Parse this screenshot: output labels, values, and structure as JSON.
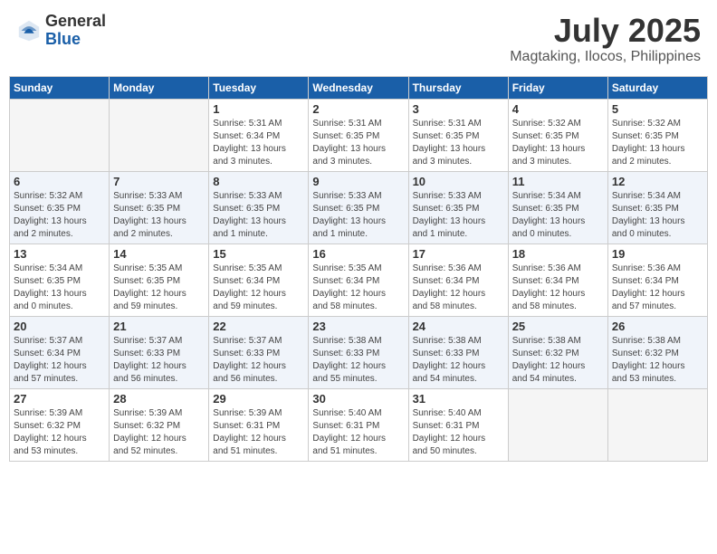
{
  "logo": {
    "general": "General",
    "blue": "Blue"
  },
  "title": "July 2025",
  "location": "Magtaking, Ilocos, Philippines",
  "days_of_week": [
    "Sunday",
    "Monday",
    "Tuesday",
    "Wednesday",
    "Thursday",
    "Friday",
    "Saturday"
  ],
  "weeks": [
    [
      {
        "day": "",
        "detail": ""
      },
      {
        "day": "",
        "detail": ""
      },
      {
        "day": "1",
        "detail": "Sunrise: 5:31 AM\nSunset: 6:34 PM\nDaylight: 13 hours\nand 3 minutes."
      },
      {
        "day": "2",
        "detail": "Sunrise: 5:31 AM\nSunset: 6:35 PM\nDaylight: 13 hours\nand 3 minutes."
      },
      {
        "day": "3",
        "detail": "Sunrise: 5:31 AM\nSunset: 6:35 PM\nDaylight: 13 hours\nand 3 minutes."
      },
      {
        "day": "4",
        "detail": "Sunrise: 5:32 AM\nSunset: 6:35 PM\nDaylight: 13 hours\nand 3 minutes."
      },
      {
        "day": "5",
        "detail": "Sunrise: 5:32 AM\nSunset: 6:35 PM\nDaylight: 13 hours\nand 2 minutes."
      }
    ],
    [
      {
        "day": "6",
        "detail": "Sunrise: 5:32 AM\nSunset: 6:35 PM\nDaylight: 13 hours\nand 2 minutes."
      },
      {
        "day": "7",
        "detail": "Sunrise: 5:33 AM\nSunset: 6:35 PM\nDaylight: 13 hours\nand 2 minutes."
      },
      {
        "day": "8",
        "detail": "Sunrise: 5:33 AM\nSunset: 6:35 PM\nDaylight: 13 hours\nand 1 minute."
      },
      {
        "day": "9",
        "detail": "Sunrise: 5:33 AM\nSunset: 6:35 PM\nDaylight: 13 hours\nand 1 minute."
      },
      {
        "day": "10",
        "detail": "Sunrise: 5:33 AM\nSunset: 6:35 PM\nDaylight: 13 hours\nand 1 minute."
      },
      {
        "day": "11",
        "detail": "Sunrise: 5:34 AM\nSunset: 6:35 PM\nDaylight: 13 hours\nand 0 minutes."
      },
      {
        "day": "12",
        "detail": "Sunrise: 5:34 AM\nSunset: 6:35 PM\nDaylight: 13 hours\nand 0 minutes."
      }
    ],
    [
      {
        "day": "13",
        "detail": "Sunrise: 5:34 AM\nSunset: 6:35 PM\nDaylight: 13 hours\nand 0 minutes."
      },
      {
        "day": "14",
        "detail": "Sunrise: 5:35 AM\nSunset: 6:35 PM\nDaylight: 12 hours\nand 59 minutes."
      },
      {
        "day": "15",
        "detail": "Sunrise: 5:35 AM\nSunset: 6:34 PM\nDaylight: 12 hours\nand 59 minutes."
      },
      {
        "day": "16",
        "detail": "Sunrise: 5:35 AM\nSunset: 6:34 PM\nDaylight: 12 hours\nand 58 minutes."
      },
      {
        "day": "17",
        "detail": "Sunrise: 5:36 AM\nSunset: 6:34 PM\nDaylight: 12 hours\nand 58 minutes."
      },
      {
        "day": "18",
        "detail": "Sunrise: 5:36 AM\nSunset: 6:34 PM\nDaylight: 12 hours\nand 58 minutes."
      },
      {
        "day": "19",
        "detail": "Sunrise: 5:36 AM\nSunset: 6:34 PM\nDaylight: 12 hours\nand 57 minutes."
      }
    ],
    [
      {
        "day": "20",
        "detail": "Sunrise: 5:37 AM\nSunset: 6:34 PM\nDaylight: 12 hours\nand 57 minutes."
      },
      {
        "day": "21",
        "detail": "Sunrise: 5:37 AM\nSunset: 6:33 PM\nDaylight: 12 hours\nand 56 minutes."
      },
      {
        "day": "22",
        "detail": "Sunrise: 5:37 AM\nSunset: 6:33 PM\nDaylight: 12 hours\nand 56 minutes."
      },
      {
        "day": "23",
        "detail": "Sunrise: 5:38 AM\nSunset: 6:33 PM\nDaylight: 12 hours\nand 55 minutes."
      },
      {
        "day": "24",
        "detail": "Sunrise: 5:38 AM\nSunset: 6:33 PM\nDaylight: 12 hours\nand 54 minutes."
      },
      {
        "day": "25",
        "detail": "Sunrise: 5:38 AM\nSunset: 6:32 PM\nDaylight: 12 hours\nand 54 minutes."
      },
      {
        "day": "26",
        "detail": "Sunrise: 5:38 AM\nSunset: 6:32 PM\nDaylight: 12 hours\nand 53 minutes."
      }
    ],
    [
      {
        "day": "27",
        "detail": "Sunrise: 5:39 AM\nSunset: 6:32 PM\nDaylight: 12 hours\nand 53 minutes."
      },
      {
        "day": "28",
        "detail": "Sunrise: 5:39 AM\nSunset: 6:32 PM\nDaylight: 12 hours\nand 52 minutes."
      },
      {
        "day": "29",
        "detail": "Sunrise: 5:39 AM\nSunset: 6:31 PM\nDaylight: 12 hours\nand 51 minutes."
      },
      {
        "day": "30",
        "detail": "Sunrise: 5:40 AM\nSunset: 6:31 PM\nDaylight: 12 hours\nand 51 minutes."
      },
      {
        "day": "31",
        "detail": "Sunrise: 5:40 AM\nSunset: 6:31 PM\nDaylight: 12 hours\nand 50 minutes."
      },
      {
        "day": "",
        "detail": ""
      },
      {
        "day": "",
        "detail": ""
      }
    ]
  ]
}
